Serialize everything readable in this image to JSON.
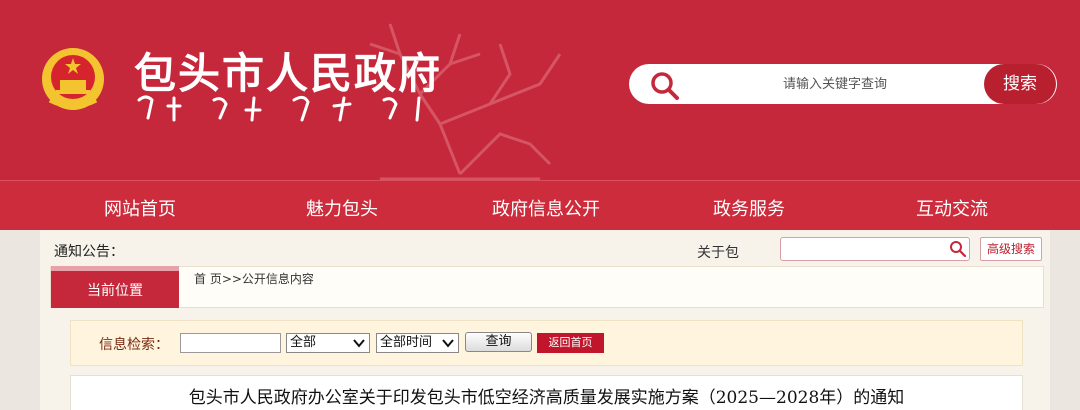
{
  "header": {
    "site_title": "包头市人民政府",
    "search_placeholder": "请输入关键字查询",
    "search_button": "搜索"
  },
  "nav": {
    "items": [
      "网站首页",
      "魅力包头",
      "政府信息公开",
      "政务服务",
      "互动交流"
    ]
  },
  "notice": {
    "label": "通知公告：",
    "ticker_text": "关于包"
  },
  "top_tools": {
    "advanced_search": "高级搜索"
  },
  "location": {
    "tab_label": "当前位置",
    "breadcrumb": "首 页>>公开信息内容"
  },
  "query": {
    "label": "信息检索：",
    "input_value": "",
    "category_select": "全部",
    "time_select": "全部时间",
    "query_button": "查询",
    "home_button": "返回首页"
  },
  "article": {
    "title": "包头市人民政府办公室关于印发包头市低空经济高质量发展实施方案（2025—2028年）的通知"
  },
  "colors": {
    "brand_red": "#c5283a",
    "nav_red": "#cd2c3c",
    "button_red": "#b8202f",
    "panel_beige": "#f7f3eb",
    "query_bar": "#fff5de"
  },
  "icons": [
    "national-emblem-icon",
    "deer-statue-icon",
    "search-icon",
    "chevron-down-icon"
  ]
}
